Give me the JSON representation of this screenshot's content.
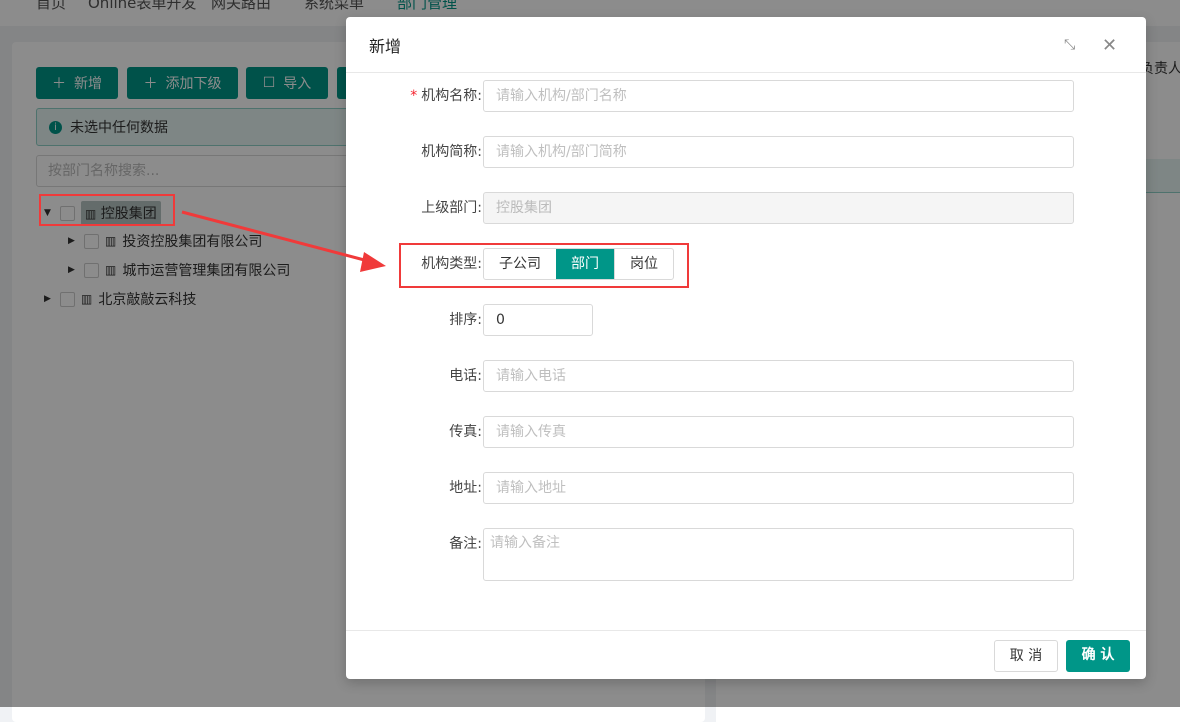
{
  "nav": [
    "首页",
    "Online表单开发",
    "网关路由",
    "系统菜单",
    "部门管理"
  ],
  "toolbar": {
    "add": "新增",
    "add_child": "添加下级",
    "import": "导入"
  },
  "alert": "未选中任何数据",
  "search_placeholder": "按部门名称搜索...",
  "tree": [
    {
      "label": "控股集团",
      "level": 0
    },
    {
      "label": "投资控股集团有限公司",
      "level": 1
    },
    {
      "label": "城市运营管理集团有限公司",
      "level": 1
    },
    {
      "label": "北京敲敲云科技",
      "level": 0
    }
  ],
  "right_header": "负责人",
  "modal": {
    "title": "新增",
    "fields": {
      "name": {
        "label": "机构名称:",
        "placeholder": "请输入机构/部门名称"
      },
      "short": {
        "label": "机构简称:",
        "placeholder": "请输入机构/部门简称"
      },
      "parent": {
        "label": "上级部门:",
        "value": "控股集团"
      },
      "type": {
        "label": "机构类型:",
        "options": [
          "子公司",
          "部门",
          "岗位"
        ],
        "selected": "部门"
      },
      "order": {
        "label": "排序:",
        "value": "0"
      },
      "phone": {
        "label": "电话:",
        "placeholder": "请输入电话"
      },
      "fax": {
        "label": "传真:",
        "placeholder": "请输入传真"
      },
      "address": {
        "label": "地址:",
        "placeholder": "请输入地址"
      },
      "memo": {
        "label": "备注:",
        "placeholder": "请输入备注"
      }
    },
    "cancel": "取 消",
    "ok": "确 认"
  }
}
